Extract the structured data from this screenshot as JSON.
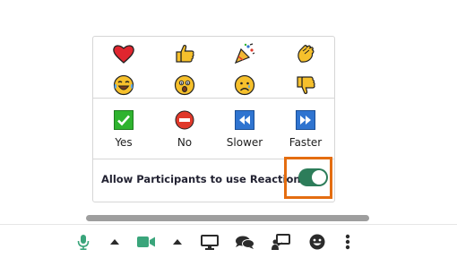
{
  "reactions_panel": {
    "emoji_row_1": [
      {
        "icon": "heart-icon"
      },
      {
        "icon": "thumbs-up-icon"
      },
      {
        "icon": "party-popper-icon"
      },
      {
        "icon": "clapping-hands-icon"
      }
    ],
    "emoji_row_2": [
      {
        "icon": "tears-of-joy-icon"
      },
      {
        "icon": "surprised-face-icon"
      },
      {
        "icon": "sad-face-icon"
      },
      {
        "icon": "thumbs-down-icon"
      }
    ],
    "status": {
      "yes_label": "Yes",
      "no_label": "No",
      "slower_label": "Slower",
      "faster_label": "Faster"
    },
    "allow_label": "Allow Participants to use Reactions",
    "allow_enabled": true
  },
  "toolbar": {
    "items": [
      {
        "icon": "microphone-icon"
      },
      {
        "icon": "chevron-up-icon"
      },
      {
        "icon": "video-camera-icon"
      },
      {
        "icon": "chevron-up-icon"
      },
      {
        "icon": "share-screen-icon"
      },
      {
        "icon": "chat-icon"
      },
      {
        "icon": "presentation-icon"
      },
      {
        "icon": "smiley-icon"
      },
      {
        "icon": "more-options-icon"
      }
    ]
  },
  "colors": {
    "accent_green": "#2d7d5a",
    "highlight_orange": "#e46d10",
    "yes_green": "#2fb32f",
    "no_red": "#e0392b",
    "speed_blue": "#2f74d0"
  }
}
